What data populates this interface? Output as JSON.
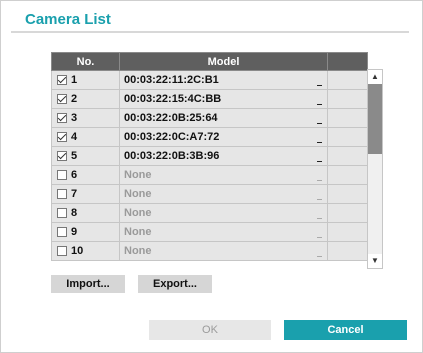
{
  "dialog": {
    "title": "Camera List"
  },
  "table": {
    "headers": {
      "no": "No.",
      "model": "Model"
    },
    "rows": [
      {
        "checked": true,
        "no": "1",
        "model": "00:03:22:11:2C:B1",
        "empty": false
      },
      {
        "checked": true,
        "no": "2",
        "model": "00:03:22:15:4C:BB",
        "empty": false
      },
      {
        "checked": true,
        "no": "3",
        "model": "00:03:22:0B:25:64",
        "empty": false
      },
      {
        "checked": true,
        "no": "4",
        "model": "00:03:22:0C:A7:72",
        "empty": false
      },
      {
        "checked": true,
        "no": "5",
        "model": "00:03:22:0B:3B:96",
        "empty": false
      },
      {
        "checked": false,
        "no": "6",
        "model": "None",
        "empty": true
      },
      {
        "checked": false,
        "no": "7",
        "model": "None",
        "empty": true
      },
      {
        "checked": false,
        "no": "8",
        "model": "None",
        "empty": true
      },
      {
        "checked": false,
        "no": "9",
        "model": "None",
        "empty": true
      },
      {
        "checked": false,
        "no": "10",
        "model": "None",
        "empty": true
      }
    ]
  },
  "buttons": {
    "import": "Import...",
    "export": "Export...",
    "ok": "OK",
    "cancel": "Cancel"
  },
  "colors": {
    "accent": "#1aa0ad",
    "header_bg": "#5f5f5f",
    "row_bg": "#e6e6e6",
    "disabled_text": "#9b9b9b"
  }
}
